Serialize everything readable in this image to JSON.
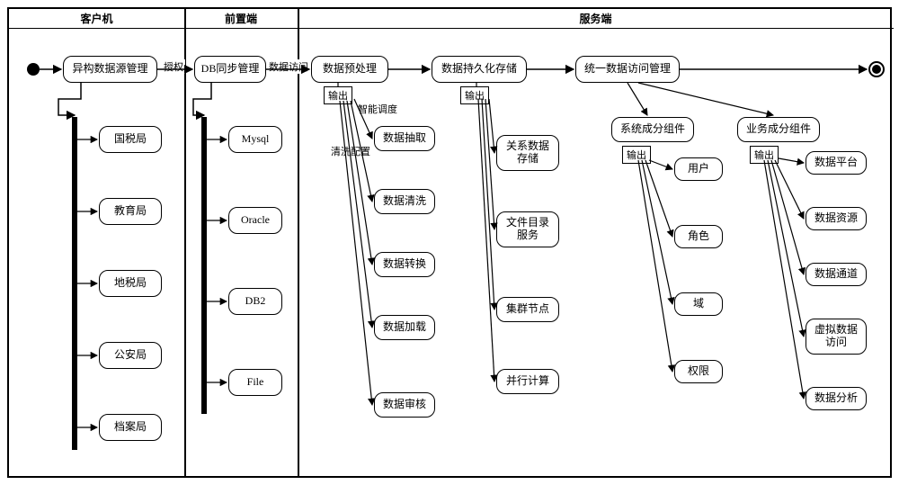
{
  "lanes": {
    "client": "客户机",
    "front": "前置端",
    "server": "服务端"
  },
  "edges": {
    "authorize": "授权",
    "dataAccess": "数据访问",
    "smartSched": "智能调度",
    "cleanCfg": "清洗配置"
  },
  "client": {
    "mgr": "异构数据源管理",
    "items": [
      "国税局",
      "教育局",
      "地税局",
      "公安局",
      "档案局"
    ]
  },
  "front": {
    "mgr": "DB同步管理",
    "items": [
      "Mysql",
      "Oracle",
      "DB2",
      "File"
    ]
  },
  "server": {
    "preproc": {
      "title": "数据预处理",
      "out": "输出",
      "items": [
        "数据抽取",
        "数据清洗",
        "数据转换",
        "数据加载",
        "数据审核"
      ]
    },
    "persist": {
      "title": "数据持久化存储",
      "out": "输出",
      "items": [
        "关系数据存储",
        "文件目录服务",
        "集群节点",
        "并行计算"
      ]
    },
    "access": {
      "title": "统一数据访问管理",
      "sys": {
        "title": "系统成分组件",
        "out": "输出",
        "items": [
          "用户",
          "角色",
          "域",
          "权限"
        ]
      },
      "biz": {
        "title": "业务成分组件",
        "out": "输出",
        "items": [
          "数据平台",
          "数据资源",
          "数据通道",
          "虚拟数据访问",
          "数据分析"
        ]
      }
    }
  },
  "chart_data": {
    "type": "diagram",
    "description": "UML activity diagram with three swimlanes showing heterogeneous data source management flowing through DB sync to server-side preprocessing, persistence, and unified data access.",
    "swimlanes": [
      "客户机",
      "前置端",
      "服务端"
    ],
    "flow": [
      "start",
      "异构数据源管理",
      "DB同步管理",
      "数据预处理",
      "数据持久化存储",
      "统一数据访问管理",
      "end"
    ],
    "transitions": [
      {
        "from": "异构数据源管理",
        "to": "DB同步管理",
        "label": "授权"
      },
      {
        "from": "DB同步管理",
        "to": "数据预处理",
        "label": "数据访问"
      }
    ],
    "forks": {
      "客户机": [
        "国税局",
        "教育局",
        "地税局",
        "公安局",
        "档案局"
      ],
      "前置端": [
        "Mysql",
        "Oracle",
        "DB2",
        "File"
      ],
      "数据预处理→输出": [
        "数据抽取",
        "数据清洗",
        "数据转换",
        "数据加载",
        "数据审核"
      ],
      "数据持久化存储→输出": [
        "关系数据存储",
        "文件目录服务",
        "集群节点",
        "并行计算"
      ],
      "统一数据访问管理": [
        "系统成分组件",
        "业务成分组件"
      ],
      "系统成分组件→输出": [
        "用户",
        "角色",
        "域",
        "权限"
      ],
      "业务成分组件→输出": [
        "数据平台",
        "数据资源",
        "数据通道",
        "虚拟数据访问",
        "数据分析"
      ]
    }
  }
}
